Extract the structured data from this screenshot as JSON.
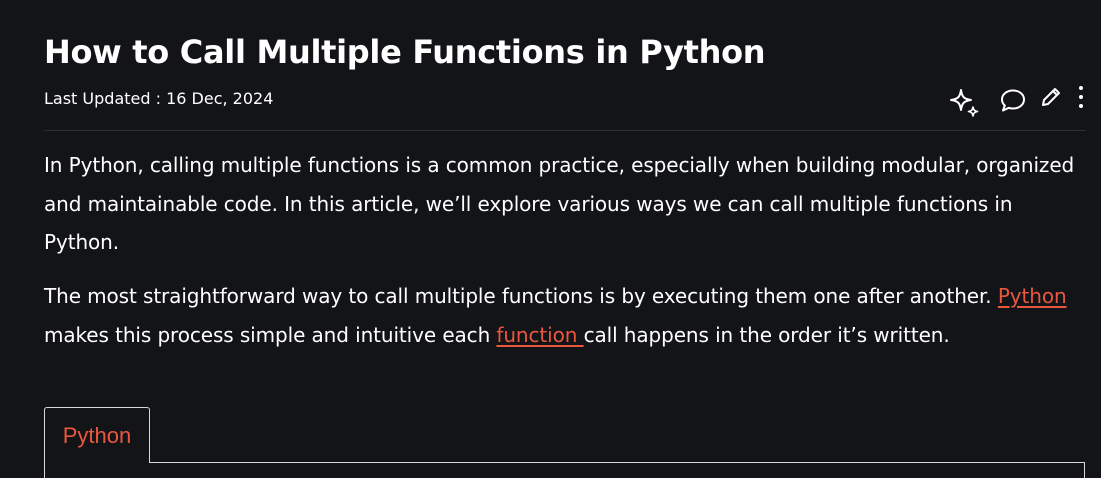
{
  "article": {
    "title": "How to Call Multiple Functions in Python",
    "last_updated": "Last Updated : 16 Dec, 2024",
    "actions": {
      "ai_icon": "sparkle-icon",
      "comment_icon": "comment-icon",
      "edit_icon": "pencil-icon",
      "more_icon": "more-vertical-icon"
    },
    "paragraph1": "In Python, calling multiple functions is a common practice, especially when building modular, organized and maintainable code. In this article, we’ll explore various ways we can call multiple functions in Python.",
    "paragraph2": {
      "part1": "The most straightforward way to call multiple functions is by executing them one after another. ",
      "link1": "Python ",
      "part2": "makes this process simple and intuitive each ",
      "link2": "function ",
      "part3": "call happens in the order it’s written."
    },
    "code_tabs": [
      "Python"
    ]
  },
  "colors": {
    "background": "#131417",
    "text": "#ffffff",
    "accent": "#e9573f",
    "divider": "#2c2e32"
  }
}
